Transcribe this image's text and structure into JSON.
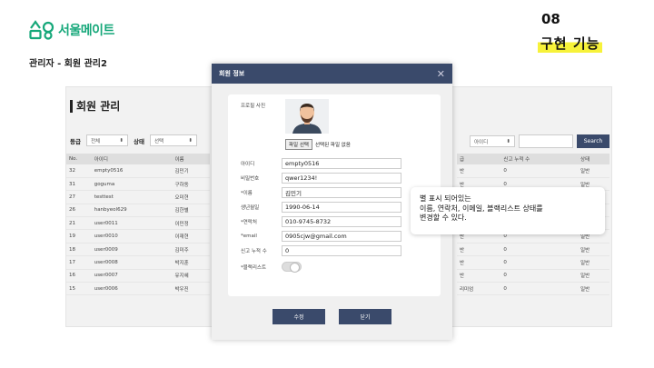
{
  "brand": {
    "name": "서울메이트",
    "color": "#16a87a"
  },
  "slide": {
    "subtitle": "관리자 - 회원 관리2",
    "number": "08",
    "title": "구현 기능",
    "highlight": "#f7f23a"
  },
  "admin": {
    "title": "회원 관리",
    "filters": {
      "grade_label": "등급",
      "grade_value": "전체",
      "status_label": "상태",
      "status_value": "선택"
    },
    "search": {
      "field": "아이디",
      "button": "Search"
    },
    "left_table": {
      "headers": [
        "No.",
        "아이디",
        "이름"
      ],
      "rows": [
        [
          "32",
          "empty0516",
          "김민기"
        ],
        [
          "31",
          "goguma",
          "구하동"
        ],
        [
          "27",
          "testtest",
          "오미현"
        ],
        [
          "26",
          "hanbyeol629",
          "김한별"
        ],
        [
          "21",
          "user0011",
          "이민정"
        ],
        [
          "19",
          "user0010",
          "이재현"
        ],
        [
          "18",
          "user0009",
          "김미주"
        ],
        [
          "17",
          "user0008",
          "박지훈"
        ],
        [
          "16",
          "user0007",
          "유지혜"
        ],
        [
          "15",
          "user0006",
          "박우진"
        ]
      ]
    },
    "right_table": {
      "headers": [
        "급",
        "신고 누적 수",
        "상태"
      ],
      "rows": [
        [
          "반",
          "0",
          "일반"
        ],
        [
          "반",
          "0",
          "일반"
        ],
        [
          "",
          "",
          ""
        ],
        [
          "",
          "",
          ""
        ],
        [
          "",
          "",
          ""
        ],
        [
          "반",
          "0",
          "일반"
        ],
        [
          "반",
          "0",
          "일반"
        ],
        [
          "반",
          "0",
          "일반"
        ],
        [
          "반",
          "0",
          "일반"
        ],
        [
          "리미엄",
          "0",
          "일반"
        ]
      ]
    }
  },
  "modal": {
    "title": "회원 정보",
    "close": "✕",
    "photo_label": "프로필 사진",
    "file_button": "파일 선택",
    "file_status": "선택된 파일 없음",
    "fields": [
      {
        "label": "아이디",
        "value": "empty0516"
      },
      {
        "label": "비밀번호",
        "value": "qwer1234!"
      },
      {
        "label": "*이름",
        "value": "김민기"
      },
      {
        "label": "생년월일",
        "value": "1990-06-14"
      },
      {
        "label": "*연락처",
        "value": "010-9745-8732"
      },
      {
        "label": "*email",
        "value": "0905cjw@gmail.com"
      },
      {
        "label": "신고 누적 수",
        "value": "0"
      }
    ],
    "blacklist_label": "*블랙리스트",
    "save_button": "수정",
    "close_button": "닫기"
  },
  "callout": {
    "lines": [
      "별 표시 되어있는",
      "이름, 연락처, 이메일, 블랙리스트 상태를",
      "변경할 수 있다."
    ]
  }
}
